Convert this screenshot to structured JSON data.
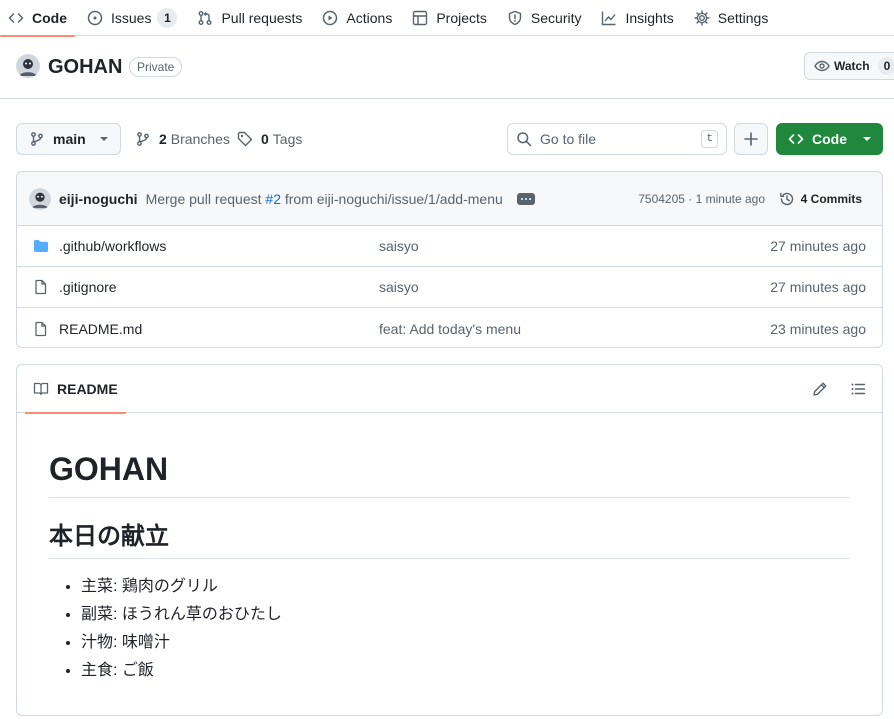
{
  "nav": {
    "tabs": [
      {
        "label": "Code",
        "icon": "code-icon"
      },
      {
        "label": "Issues",
        "icon": "issue-icon",
        "count": "1"
      },
      {
        "label": "Pull requests",
        "icon": "pull-request-icon"
      },
      {
        "label": "Actions",
        "icon": "play-icon"
      },
      {
        "label": "Projects",
        "icon": "table-icon"
      },
      {
        "label": "Security",
        "icon": "shield-icon"
      },
      {
        "label": "Insights",
        "icon": "graph-icon"
      },
      {
        "label": "Settings",
        "icon": "gear-icon"
      }
    ]
  },
  "repo": {
    "name": "GOHAN",
    "visibility": "Private",
    "watch_label": "Watch",
    "watch_count": "0"
  },
  "toolbar": {
    "branch": "main",
    "branches_count": "2",
    "branches_label": "Branches",
    "tags_count": "0",
    "tags_label": "Tags",
    "goto_placeholder": "Go to file",
    "goto_shortcut": "t",
    "code_label": "Code"
  },
  "commit": {
    "author": "eiji-noguchi",
    "message_prefix": "Merge pull request",
    "pr_link": "#2",
    "message_suffix": "from eiji-noguchi/issue/1/add-menu",
    "sha_time": "7504205 · 1 minute ago",
    "commits_label": "4 Commits"
  },
  "files": [
    {
      "name": ".github/workflows",
      "type": "folder",
      "message": "saisyo",
      "age": "27 minutes ago"
    },
    {
      "name": ".gitignore",
      "type": "file",
      "message": "saisyo",
      "age": "27 minutes ago"
    },
    {
      "name": "README.md",
      "type": "file",
      "message": "feat: Add today's menu",
      "age": "23 minutes ago"
    }
  ],
  "readme": {
    "tab_label": "README",
    "h1": "GOHAN",
    "h2": "本日の献立",
    "items": [
      "主菜: 鶏肉のグリル",
      "副菜: ほうれん草のおひたし",
      "汁物: 味噌汁",
      "主食: ご飯"
    ]
  },
  "colors": {
    "accent_underline": "#fd8c73",
    "primary_button": "#1f883d",
    "folder": "#54aeff",
    "link": "#0969da"
  }
}
